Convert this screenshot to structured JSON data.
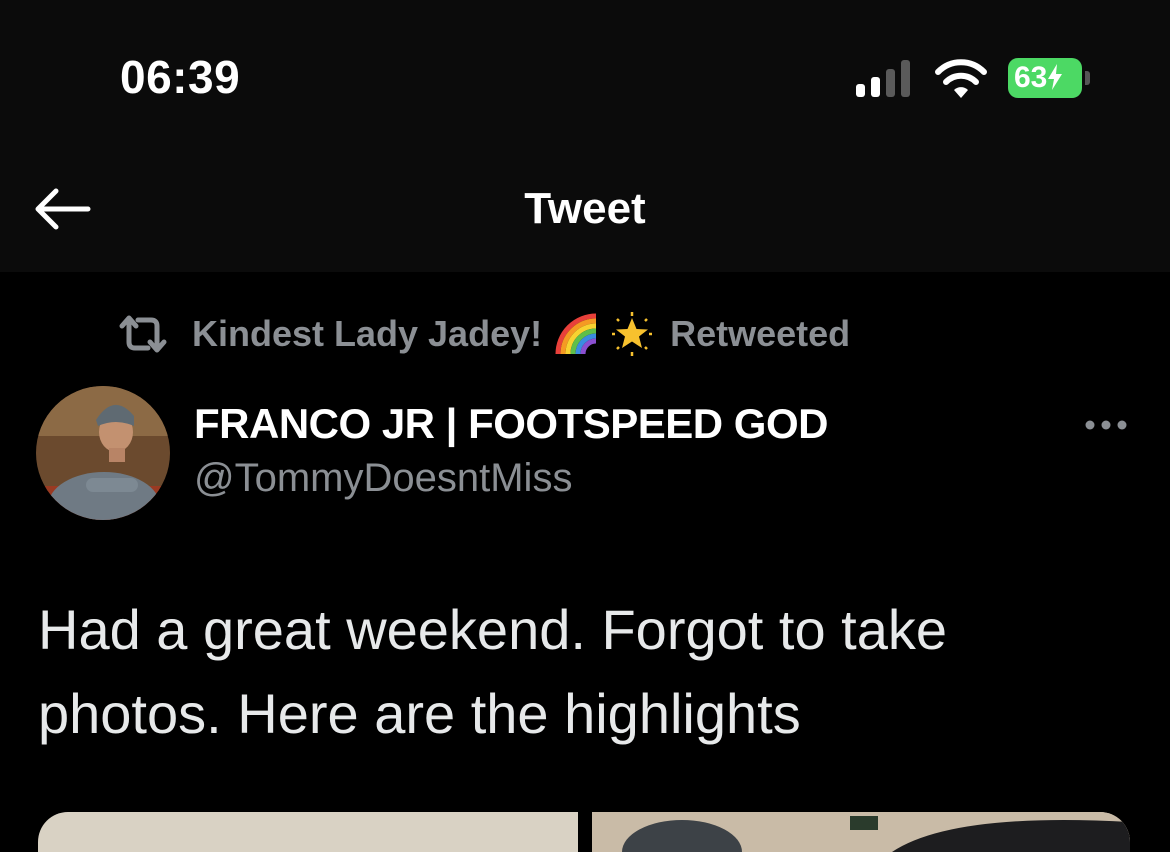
{
  "status_bar": {
    "time": "06:39",
    "battery_level": "63",
    "battery_charging": true,
    "signal_icon": "cellular-signal-icon",
    "wifi_icon": "wifi-icon",
    "battery_color": "#4cd964"
  },
  "nav": {
    "title": "Tweet",
    "back_icon": "back-arrow-icon"
  },
  "retweet": {
    "retweeter": "Kindest Lady Jadey!",
    "emojis": [
      "rainbow-emoji",
      "glowing-star-emoji"
    ],
    "suffix": "Retweeted",
    "icon": "retweet-icon"
  },
  "tweet": {
    "author_name": "FRANCO JR | FOOTSPEED GOD",
    "handle": "@TommyDoesntMiss",
    "text": "Had a great weekend. Forgot to take photos. Here are the highlights",
    "more_icon": "more-icon"
  },
  "colors": {
    "background": "#000000",
    "bar_background": "#0b0b0b",
    "secondary_text": "#8b8f94",
    "primary_text": "#e7e9ea"
  }
}
